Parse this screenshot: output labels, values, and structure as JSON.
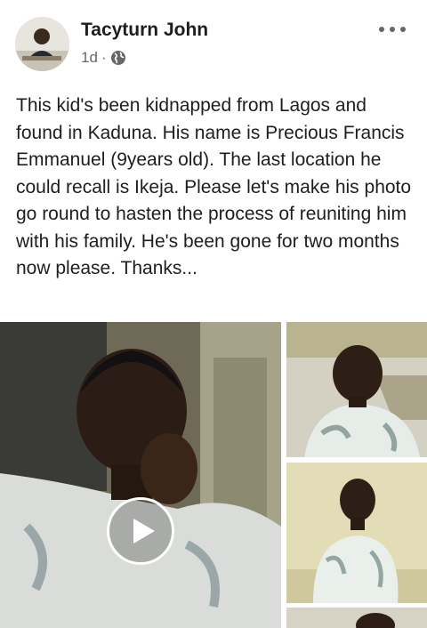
{
  "post": {
    "author": "Tacyturn John",
    "time": "1d",
    "separator": "·",
    "privacy_icon": "globe-icon",
    "more_icon": "more-options-icon",
    "text": "This kid's been kidnapped from Lagos and found in Kaduna. His name is Precious Francis Emmanuel (9years old). The last location he could recall is Ikeja. Please let's make his photo go round to hasten the process of reuniting him with his family. He's been gone for two months now please. Thanks..."
  },
  "media": {
    "play_icon": "play-icon"
  },
  "colors": {
    "text": "#1c1e21",
    "meta": "#65676b",
    "background": "#ffffff"
  }
}
